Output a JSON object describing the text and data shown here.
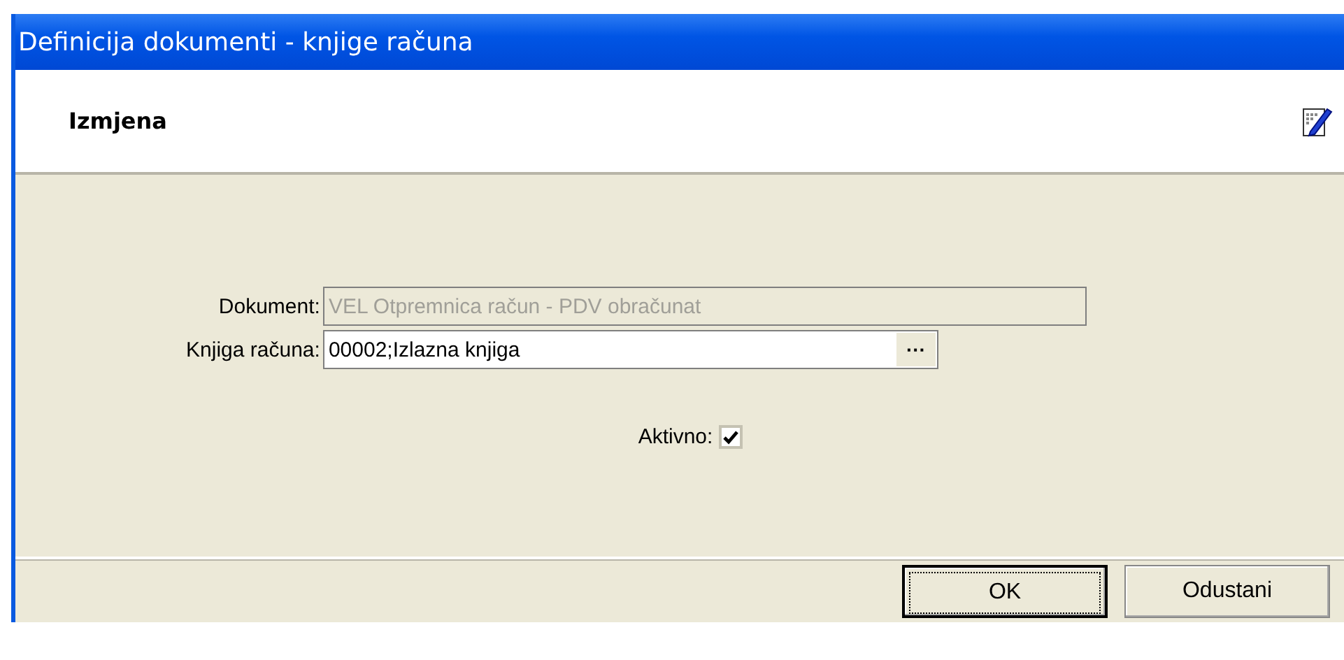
{
  "window": {
    "title": "Definicija dokumenti - knjige računa"
  },
  "header": {
    "title": "Izmjena"
  },
  "fields": [
    {
      "kind": "text",
      "label": "Dokument:",
      "value": "VEL Otpremnica račun - PDV obračunat",
      "disabled": true
    },
    {
      "kind": "lookup",
      "label": "Knjiga računa:",
      "value": "00002;Izlazna knjiga",
      "disabled": false,
      "button": "···"
    }
  ],
  "active": {
    "label": "Aktivno:",
    "checked": true
  },
  "buttons": [
    {
      "label": "OK",
      "default": true
    },
    {
      "label": "Odustani",
      "default": false
    }
  ]
}
